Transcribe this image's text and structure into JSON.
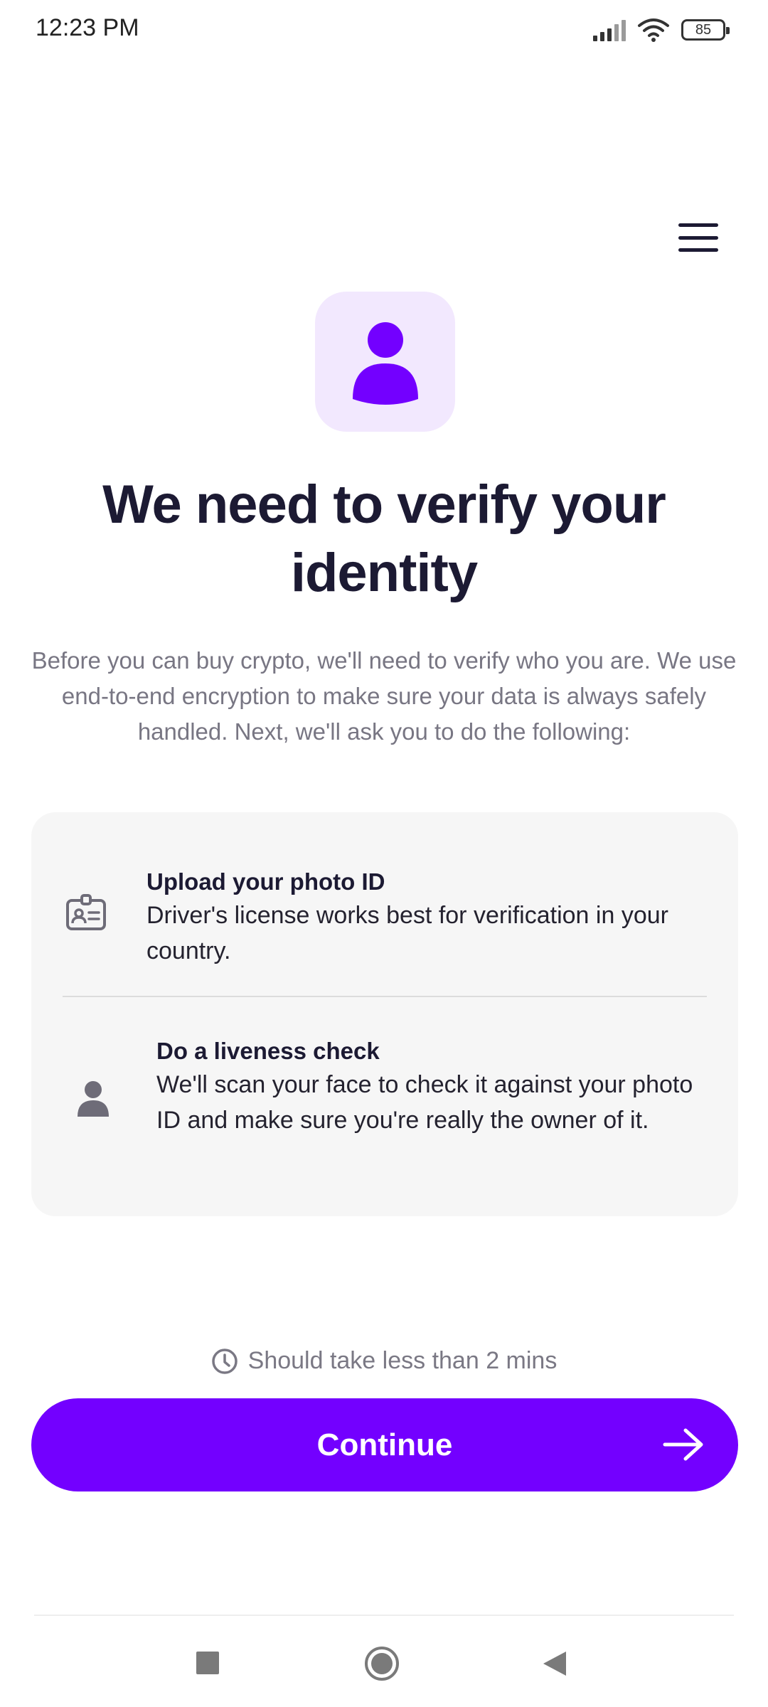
{
  "status_bar": {
    "time": "12:23 PM",
    "battery": "85",
    "icons": [
      "signal-icon",
      "wifi-icon",
      "battery-icon"
    ]
  },
  "header": {
    "menu_icon": "hamburger-menu-icon"
  },
  "hero": {
    "icon": "user-icon",
    "title": "We need to verify your identity",
    "description": "Before you can buy crypto, we'll need to verify who you are. We use end-to-end encryption to make sure your data is always safely handled. Next, we'll ask you to do the following:"
  },
  "steps": [
    {
      "icon": "id-card-icon",
      "title": "Upload your photo ID",
      "description": "Driver's license works best for verification in your country."
    },
    {
      "icon": "person-icon",
      "title": "Do a liveness check",
      "description": "We'll scan your face to check it against your photo ID and make sure you're really the owner of it."
    }
  ],
  "time_hint": {
    "icon": "clock-icon",
    "text": "Should take less than 2 mins"
  },
  "continue_button": {
    "label": "Continue",
    "icon": "arrow-right-icon"
  },
  "navigation": {
    "items": [
      "recents-square-icon",
      "home-circle-icon",
      "back-triangle-icon"
    ]
  },
  "colors": {
    "accent": "#7300ff",
    "accent_light": "#f2e8fe",
    "title": "#1c1a33",
    "muted": "#787683",
    "card_bg": "#f6f6f6"
  }
}
